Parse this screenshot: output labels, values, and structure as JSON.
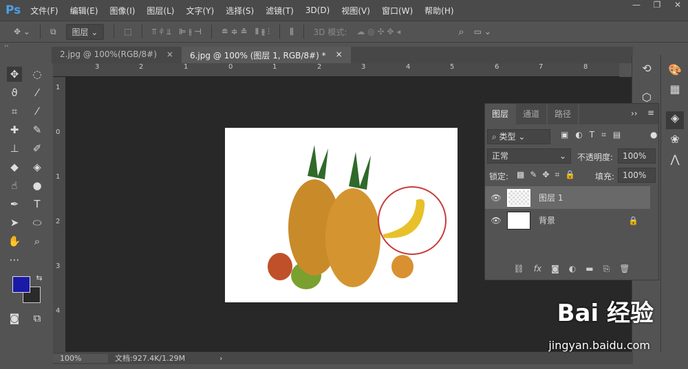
{
  "app": {
    "logo": "Ps"
  },
  "menu": [
    "文件(F)",
    "编辑(E)",
    "图像(I)",
    "图层(L)",
    "文字(Y)",
    "选择(S)",
    "滤镜(T)",
    "3D(D)",
    "视图(V)",
    "窗口(W)",
    "帮助(H)"
  ],
  "window_controls": [
    "—",
    "❐",
    "✕"
  ],
  "options": {
    "auto_select": "图层",
    "mode_3d": "3D 模式:"
  },
  "tabs": [
    {
      "label": "2.jpg @ 100%(RGB/8#)",
      "close": "×"
    },
    {
      "label": "6.jpg @ 100% (图层 1, RGB/8#) *",
      "close": "×"
    }
  ],
  "ruler": {
    "h": [
      "3",
      "2",
      "1",
      "0",
      "1",
      "2",
      "3",
      "4",
      "5",
      "6",
      "7",
      "8"
    ],
    "v": [
      "1",
      "0",
      "1",
      "2",
      "3",
      "4"
    ]
  },
  "status": {
    "zoom": "100%",
    "doc": "文档:927.4K/1.29M",
    "arrow": "›"
  },
  "colors": {
    "foreground": "#1a1aa8",
    "background": "#2a2a2a",
    "accent": "#4aa0e8"
  },
  "layers_panel": {
    "tabs": [
      "图层",
      "通道",
      "路径"
    ],
    "menu_glyph": "≡",
    "expand": "››",
    "filter": "类型",
    "blend_mode": "正常",
    "opacity_label": "不透明度:",
    "opacity": "100%",
    "lock_label": "锁定:",
    "fill_label": "填充:",
    "fill": "100%",
    "layers": [
      {
        "name": "图层 1",
        "selected": true
      },
      {
        "name": "背景",
        "locked": true
      }
    ]
  },
  "watermark": {
    "brand": "Bai 经验",
    "url": "jingyan.baidu.com"
  }
}
